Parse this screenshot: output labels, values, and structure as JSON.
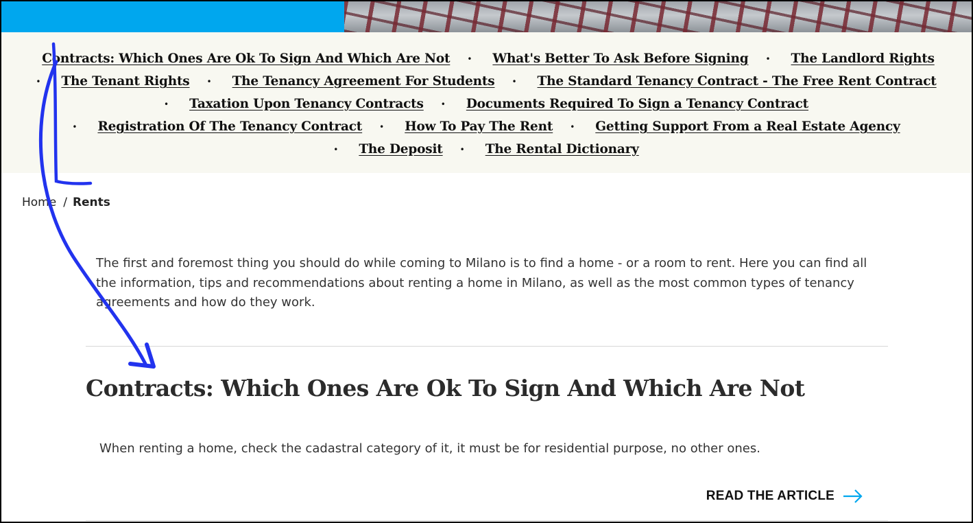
{
  "banner": {
    "accent_color": "#00a7ee"
  },
  "nav": {
    "rows": [
      {
        "lead_sep": false,
        "items": [
          "Contracts: Which Ones Are Ok To Sign And Which Are Not",
          "What's Better To Ask Before Signing",
          "The Landlord Rights"
        ]
      },
      {
        "lead_sep": true,
        "items": [
          "The Tenant Rights",
          "The Tenancy Agreement For Students",
          "The Standard Tenancy Contract - The Free Rent Contract"
        ]
      },
      {
        "lead_sep": true,
        "items": [
          "Taxation Upon Tenancy Contracts",
          "Documents Required To Sign a Tenancy Contract"
        ]
      },
      {
        "lead_sep": true,
        "items": [
          "Registration Of The Tenancy Contract",
          "How To Pay The Rent",
          "Getting Support From a Real Estate Agency"
        ]
      },
      {
        "lead_sep": true,
        "items": [
          "The Deposit",
          "The Rental Dictionary"
        ]
      }
    ],
    "separator": "•"
  },
  "breadcrumb": {
    "home": "Home",
    "separator": "/",
    "current": "Rents"
  },
  "intro": {
    "text": "The first and foremost thing you should do while coming to Milano is to find a home - or a room to rent. Here you can find all the information, tips and recommendations about renting a home in Milano, as well as the most common types of tenancy agreements and how do they work."
  },
  "article": {
    "title": "Contracts: Which Ones Are Ok To Sign And Which Are Not",
    "summary": "When renting a home, check the cadastral category of it, it must be for residential purpose, no other ones.",
    "read_more": "READ THE ARTICLE",
    "arrow_icon": "arrow-right-icon",
    "arrow_color": "#00a7ee"
  },
  "annotation": {
    "color": "#2233ee",
    "icon": "curved-arrow-annotation"
  }
}
